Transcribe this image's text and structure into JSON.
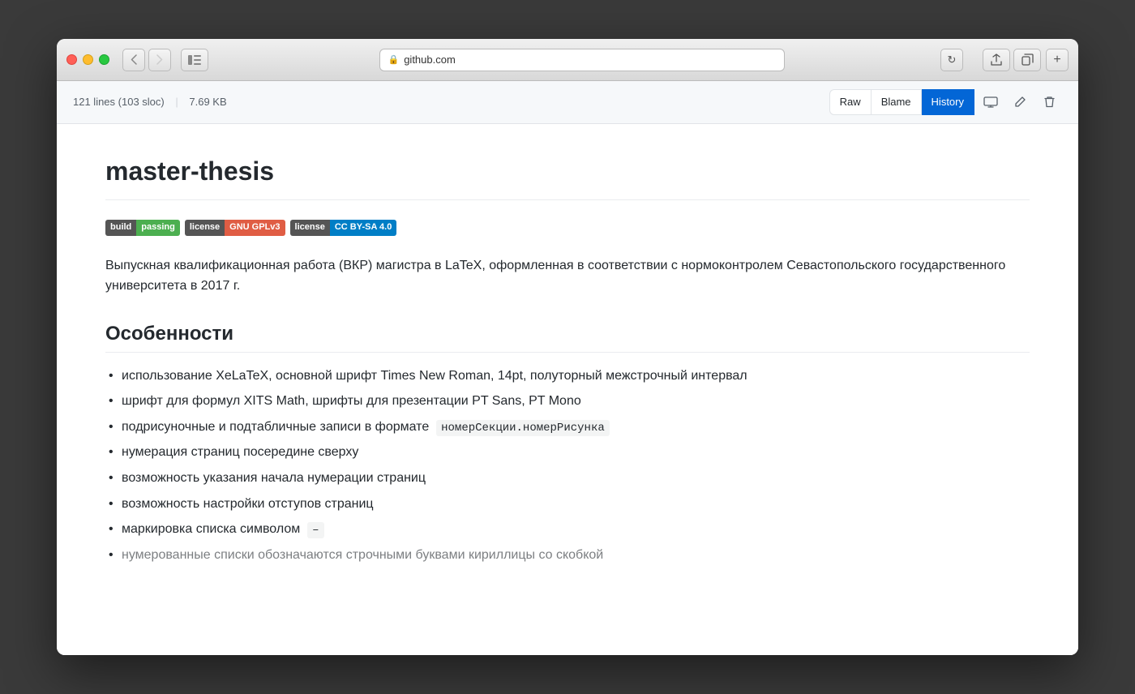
{
  "browser": {
    "url": "github.com",
    "url_secure": true
  },
  "file_header": {
    "lines": "121 lines (103 sloc)",
    "divider": "|",
    "size": "7.69 KB",
    "btn_raw": "Raw",
    "btn_blame": "Blame",
    "btn_history": "History"
  },
  "readme": {
    "title": "master-thesis",
    "badges": [
      {
        "left": "build",
        "right": "passing",
        "color": "green"
      },
      {
        "left": "license",
        "right": "GNU GPLv3",
        "color": "orange"
      },
      {
        "left": "license",
        "right": "CC BY-SA 4.0",
        "color": "blue"
      }
    ],
    "description": "Выпускная квалификационная работа (ВКР) магистра в LaTeX, оформленная в соответствии с нормоконтролем Севастопольского государственного университета в 2017 г.",
    "section_title": "Особенности",
    "features": [
      {
        "text": "использование XeLaTeX, основной шрифт Times New Roman, 14pt, полуторный межстрочный интервал",
        "code": null
      },
      {
        "text": "шрифт для формул XITS Math, шрифты для презентации PT Sans, PT Mono",
        "code": null
      },
      {
        "text_before": "подрисуночные и подтабличные записи в формате",
        "code": "номерСекции.номерРисунка",
        "text_after": ""
      },
      {
        "text": "нумерация страниц посередине сверху",
        "code": null
      },
      {
        "text": "возможность указания начала нумерации страниц",
        "code": null
      },
      {
        "text": "возможность настройки отступов страниц",
        "code": null
      },
      {
        "text_before": "маркировка списка символом",
        "code": "–",
        "text_after": ""
      },
      {
        "text": "нумерованные списки обозначаются строчными буквами кириллицы со скобкой",
        "code": null,
        "partial": true
      }
    ]
  }
}
